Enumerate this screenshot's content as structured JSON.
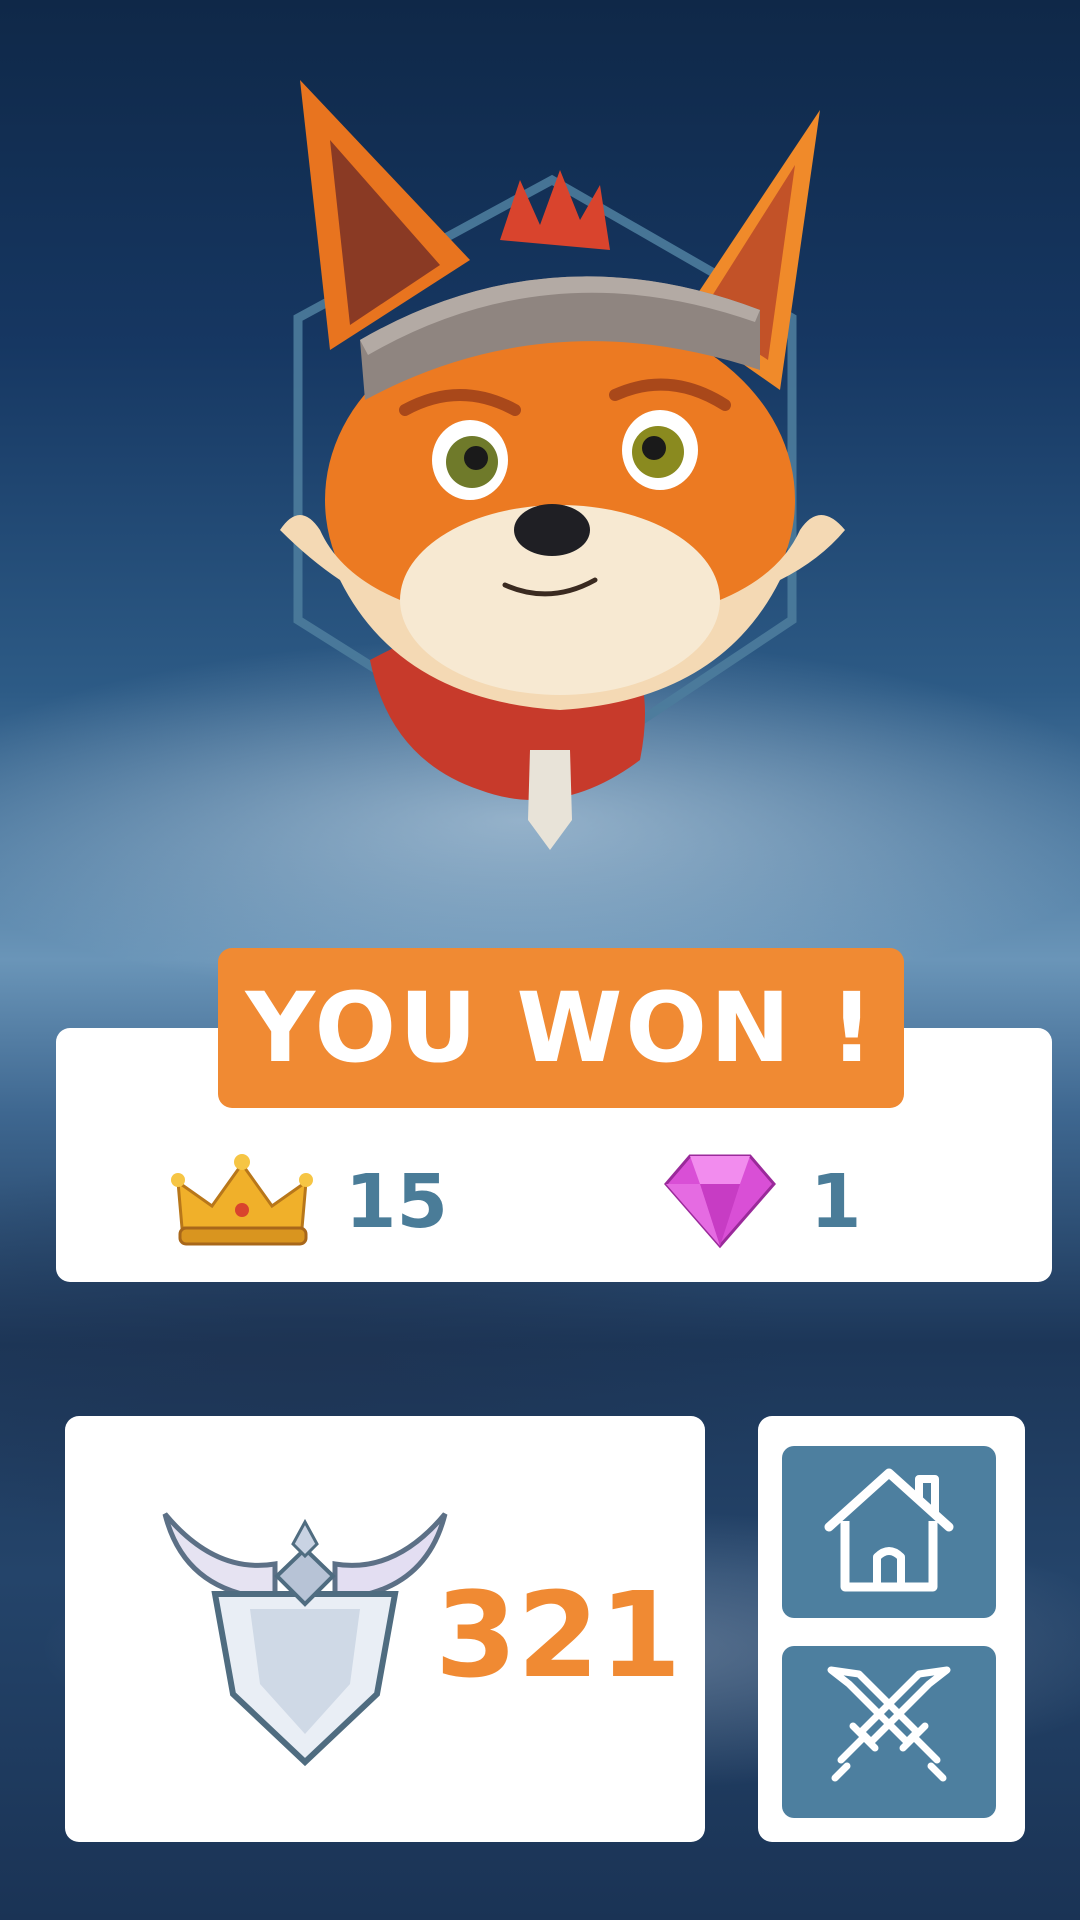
{
  "result": {
    "title": "YOU WON !"
  },
  "rewards": {
    "crowns": "15",
    "gems": "1"
  },
  "rank": {
    "trophies": "321"
  },
  "actions": {
    "home_icon": "home-icon",
    "battle_icon": "crossed-swords-icon"
  },
  "colors": {
    "accent": "#f08a33",
    "button": "#4d7f9f",
    "reward_text": "#4a7c98",
    "card": "#ffffff"
  }
}
